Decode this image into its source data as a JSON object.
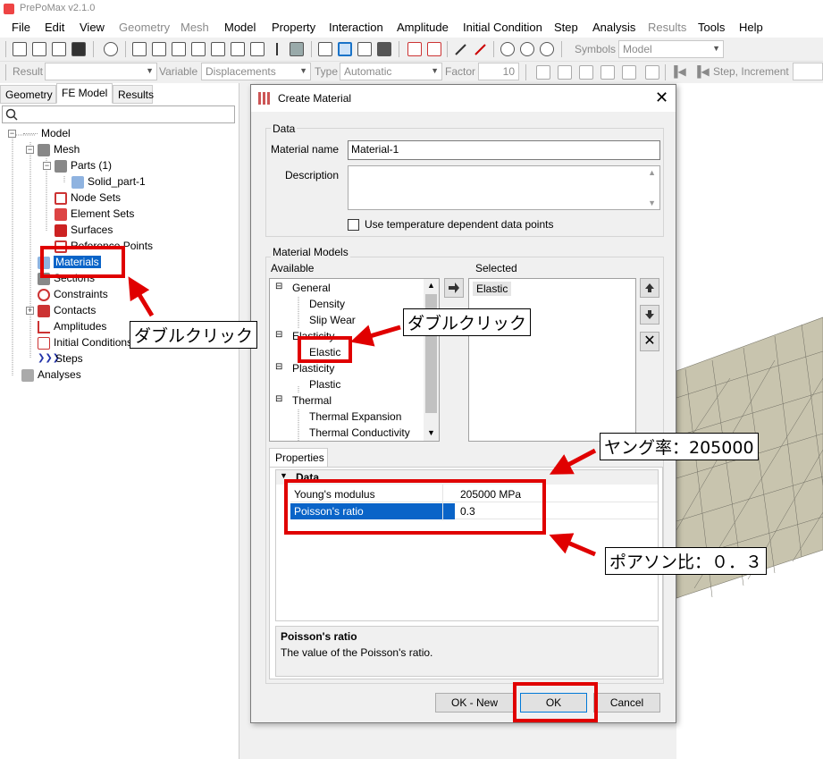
{
  "app": {
    "title": "PrePoMax v2.1.0"
  },
  "menu": [
    "File",
    "Edit",
    "View",
    "Geometry",
    "Mesh",
    "Model",
    "Property",
    "Interaction",
    "Amplitude",
    "Initial Condition",
    "Step",
    "Analysis",
    "Results",
    "Tools",
    "Help"
  ],
  "menu_disabled": [
    "Geometry",
    "Mesh",
    "Results"
  ],
  "toolbar1": {
    "symbols_label": "Symbols",
    "symbols_value": "Model"
  },
  "toolbar2": {
    "result_label": "Result",
    "variable_label": "Variable",
    "variable_value": "Displacements",
    "type_label": "Type",
    "type_value": "Automatic",
    "factor_label": "Factor",
    "factor_value": "10",
    "step_increment_label": "Step, Increment"
  },
  "left_tabs": {
    "geometry": "Geometry",
    "fe_model": "FE Model",
    "results": "Results"
  },
  "tree": {
    "model": "Model",
    "mesh": "Mesh",
    "parts": "Parts (1)",
    "solid_part": "Solid_part-1",
    "node_sets": "Node Sets",
    "element_sets": "Element Sets",
    "surfaces": "Surfaces",
    "reference_points": "Reference Points",
    "materials": "Materials",
    "sections": "Sections",
    "constraints": "Constraints",
    "contacts": "Contacts",
    "amplitudes": "Amplitudes",
    "initial_conditions": "Initial Conditions",
    "steps": "Steps",
    "analyses": "Analyses"
  },
  "dialog": {
    "title": "Create Material",
    "data_group": "Data",
    "material_name_label": "Material name",
    "material_name_value": "Material-1",
    "description_label": "Description",
    "temp_checkbox_label": "Use temperature dependent data points",
    "models_group": "Material Models",
    "available_label": "Available",
    "selected_label": "Selected",
    "available": {
      "general": "General",
      "density": "Density",
      "slip_wear": "Slip Wear",
      "elasticity": "Elasticity",
      "elastic": "Elastic",
      "plasticity": "Plasticity",
      "plastic": "Plastic",
      "thermal": "Thermal",
      "thermal_expansion": "Thermal Expansion",
      "thermal_conductivity": "Thermal Conductivity"
    },
    "selected_items": [
      "Elastic"
    ],
    "properties_tab": "Properties",
    "prop_category": "Data",
    "properties": [
      {
        "name": "Young's modulus",
        "value": "205000 MPa"
      },
      {
        "name": "Poisson's ratio",
        "value": "0.3"
      }
    ],
    "help_title": "Poisson's ratio",
    "help_text": "The value of the Poisson's ratio.",
    "ok_new_button": "OK - New",
    "ok_button": "OK",
    "cancel_button": "Cancel"
  },
  "annotations": {
    "double_click_1": "ダブルクリック",
    "double_click_2": "ダブルクリック",
    "youngs": "ヤング率：205000",
    "poisson": "ポアソン比：０．３"
  },
  "colors": {
    "annotation_red": "#e00000",
    "selection_blue": "#0a64c8",
    "mesh_fill": "#c8c4ae"
  }
}
